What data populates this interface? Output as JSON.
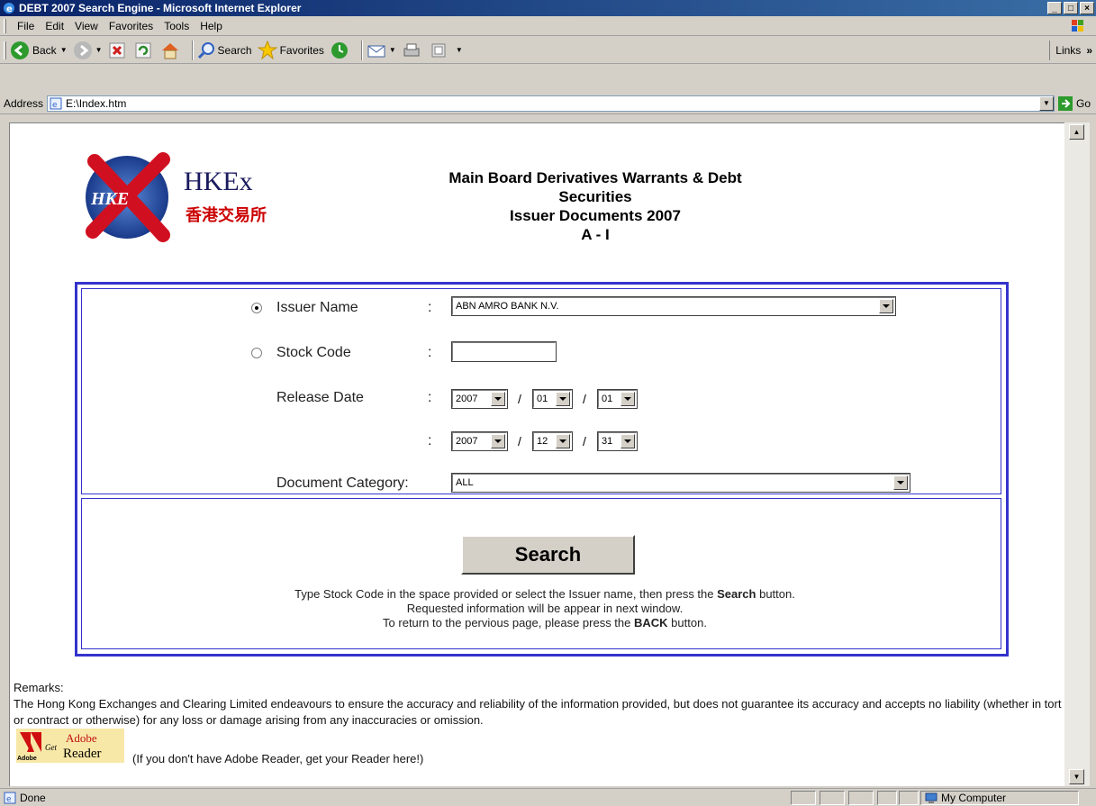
{
  "window": {
    "title": "DEBT 2007 Search Engine - Microsoft Internet Explorer",
    "min": "_",
    "max": "□",
    "close": "×"
  },
  "menu": [
    "File",
    "Edit",
    "View",
    "Favorites",
    "Tools",
    "Help"
  ],
  "toolbar": {
    "back": "Back",
    "search": "Search",
    "favorites": "Favorites",
    "links": "Links",
    "links_more": "»"
  },
  "address": {
    "label": "Address",
    "value": "E:\\Index.htm",
    "go": "Go"
  },
  "logo": {
    "text": "HKEx",
    "chinese": "香港交易所",
    "badge": "HKE"
  },
  "page": {
    "title_line1": "Main Board Derivatives Warrants & Debt",
    "title_line2": "Securities",
    "title_line3": "Issuer Documents 2007",
    "title_line4": "A - I"
  },
  "form": {
    "issuer_label": "Issuer Name",
    "issuer_value": "ABN AMRO BANK N.V.",
    "stock_label": "Stock Code",
    "stock_value": "",
    "release_label": "Release Date",
    "colon": ":",
    "slash": "/",
    "from": {
      "year": "2007",
      "month": "01",
      "day": "01"
    },
    "to": {
      "year": "2007",
      "month": "12",
      "day": "31"
    },
    "category_label": "Document Category:",
    "category_value": "ALL",
    "issuer_selected": true
  },
  "search": {
    "button": "Search",
    "line1_pre": "Type Stock Code in the space provided or select the Issuer name, then press the ",
    "line1_bold": "Search",
    "line1_post": " button.",
    "line2": "Requested information will be appear in next window.",
    "line3_pre": "To return to the pervious page, please press the ",
    "line3_bold": "BACK",
    "line3_post": " button."
  },
  "remarks": {
    "heading": "Remarks:",
    "text": "The Hong Kong Exchanges and Clearing Limited endeavours to ensure the accuracy and reliability of the information provided, but does not guarantee its accuracy and accepts no liability (whether in tort or contract or otherwise) for any loss or damage arising from any inaccuracies or omission.",
    "adobe_note": "(If you don't have Adobe Reader, get your Reader here!)",
    "adobe_get": "Get",
    "adobe_brand": "Adobe",
    "adobe_product": "Reader",
    "adobe_small": "Adobe"
  },
  "status": {
    "left": "Done",
    "zone": "My Computer"
  },
  "colors": {
    "form_border": "#3333cc",
    "title_blue": "#0a246a",
    "logo_red": "#c00000"
  }
}
